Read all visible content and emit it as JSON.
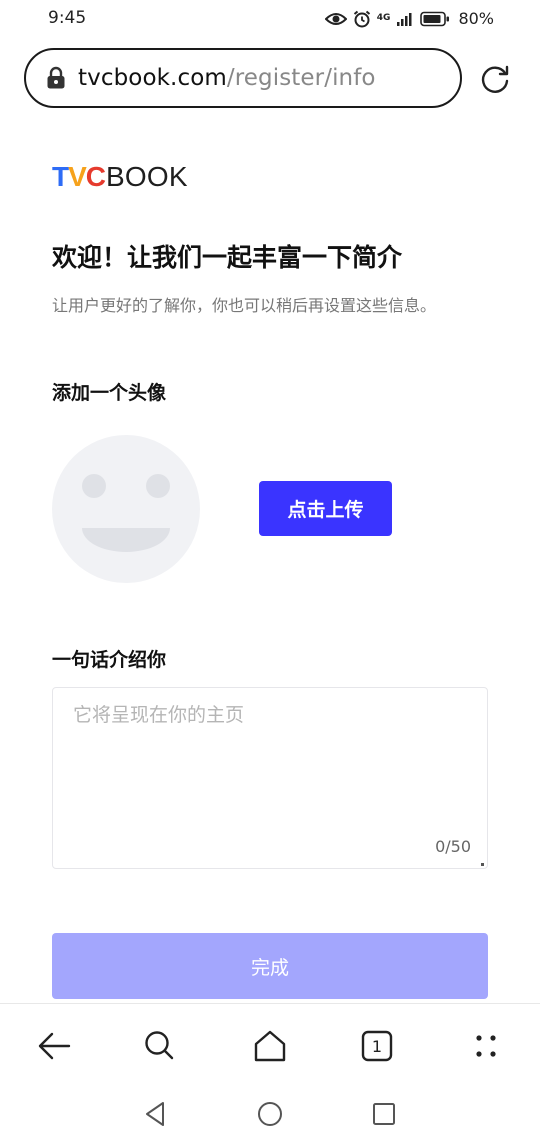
{
  "status_bar": {
    "time": "9:45",
    "network": "4G",
    "battery": "80%"
  },
  "browser": {
    "url_host": "tvcbook.com",
    "url_path": "/register/info",
    "tab_count": "1"
  },
  "logo": {
    "letters": [
      "T",
      "V",
      "C"
    ],
    "letter_colors": [
      "#2e6cf6",
      "#f6a21c",
      "#e63b2e"
    ],
    "suffix": "BOOK"
  },
  "page": {
    "title": "欢迎！让我们一起丰富一下简介",
    "subtitle": "让用户更好的了解你，你也可以稍后再设置这些信息。"
  },
  "avatar_section": {
    "heading": "添加一个头像",
    "upload_label": "点击上传",
    "upload_color": "#3a34ff"
  },
  "intro_section": {
    "heading": "一句话介绍你",
    "placeholder": "它将呈现在你的主页",
    "value": "",
    "char_count": "0/50"
  },
  "submit": {
    "label": "完成",
    "color": "#a3a6fd"
  },
  "icons": {
    "toolbar": [
      "back-arrow-icon",
      "search-icon",
      "home-icon",
      "tabs-icon",
      "more-icon"
    ],
    "system_nav": [
      "nav-back-icon",
      "nav-home-icon",
      "nav-recents-icon"
    ]
  }
}
